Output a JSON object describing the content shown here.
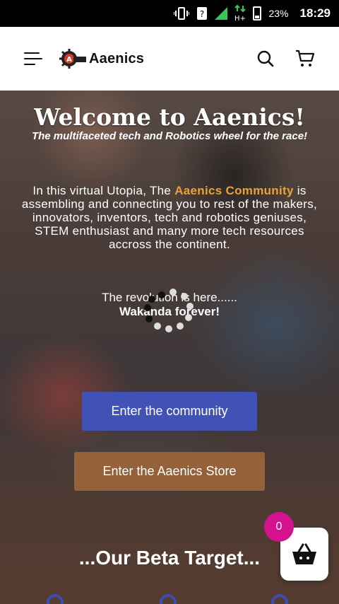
{
  "status_bar": {
    "battery_percent": "23%",
    "time": "18:29",
    "network_type": "H+",
    "icons": [
      "vibrate-icon",
      "unknown-notification-icon",
      "signal-icon",
      "data-arrows-icon",
      "battery-icon"
    ]
  },
  "header": {
    "logo_text": "Aaenics",
    "icons": [
      "menu-icon",
      "search-icon",
      "cart-icon"
    ]
  },
  "hero": {
    "title": "Welcome to Aaenics!",
    "tagline": "The multifaceted tech and Robotics wheel for the race!",
    "intro_prefix": "In this virtual Utopia, The ",
    "intro_highlight": "Aaenics Community",
    "intro_suffix": " is assembling and connecting you to rest of the makers, innovators, inventors, tech and robotics geniuses, STEM enthusiast and many more tech resources accross the continent.",
    "revolution_text": "The revolution is here......",
    "wakanda_text": "Wakanda forever!",
    "community_button": "Enter the community",
    "store_button": "Enter the Aaenics Store",
    "beta_heading": "...Our Beta Target..."
  },
  "floating_cart": {
    "count": "0",
    "icon": "basket-icon"
  },
  "colors": {
    "community_button": "#4052b5",
    "store_button": "#94613a",
    "highlight": "#e8a23d",
    "badge": "#d4128d"
  }
}
